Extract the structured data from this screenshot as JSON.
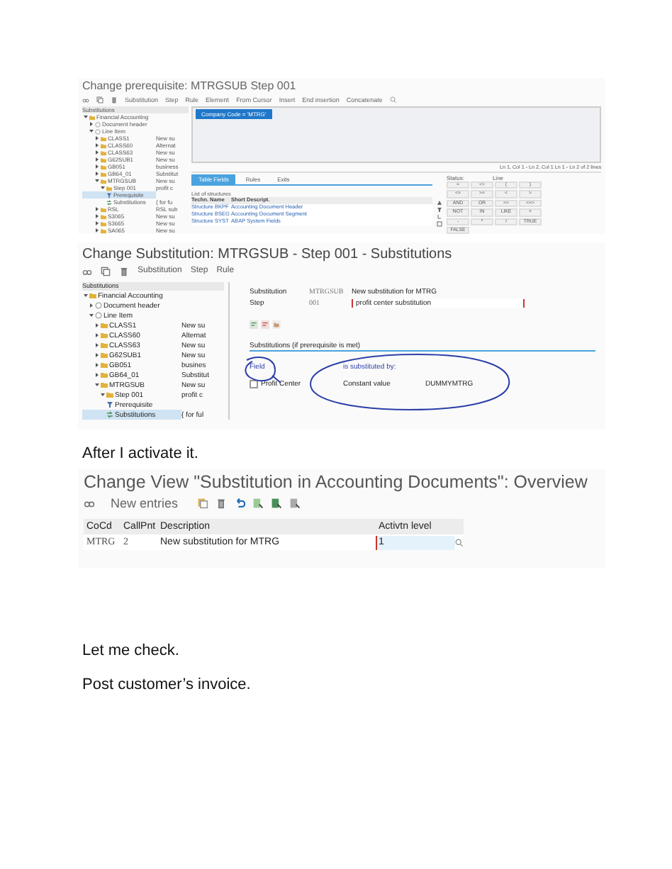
{
  "prerequisite_screen": {
    "title": "Change prerequisite: MTRGSUB Step 001",
    "toolbar": [
      "Substitution",
      "Step",
      "Rule",
      "Element",
      "From Cursor",
      "Insert",
      "End insertion",
      "Concatenate"
    ],
    "tree_header": "Substitutions",
    "tree": [
      {
        "label": "Financial Accounting",
        "kind": "folder",
        "expanded": true,
        "selected": false,
        "children": [
          {
            "label": "Document header",
            "kind": "node",
            "expanded": false,
            "selected": false
          },
          {
            "label": "Line Item",
            "kind": "node",
            "expanded": true,
            "selected": false,
            "children": [
              {
                "label": "CLASS1",
                "kind": "folder",
                "expanded": false,
                "selected": false,
                "note": "New su"
              },
              {
                "label": "CLASS60",
                "kind": "folder",
                "expanded": false,
                "selected": false,
                "note": "Alternat"
              },
              {
                "label": "CLASS63",
                "kind": "folder",
                "expanded": false,
                "selected": false,
                "note": "New su"
              },
              {
                "label": "G62SUB1",
                "kind": "folder",
                "expanded": false,
                "selected": false,
                "note": "New su"
              },
              {
                "label": "GB051",
                "kind": "folder",
                "expanded": false,
                "selected": false,
                "note": "business"
              },
              {
                "label": "GB64_01",
                "kind": "folder",
                "expanded": false,
                "selected": false,
                "note": "Substitut"
              },
              {
                "label": "MTRGSUB",
                "kind": "folder",
                "expanded": true,
                "selected": false,
                "note": "New su",
                "children": [
                  {
                    "label": "Step 001",
                    "kind": "folder",
                    "expanded": true,
                    "selected": false,
                    "note": "profit c",
                    "children": [
                      {
                        "label": "Prerequisite",
                        "kind": "prerequisite",
                        "selected": true
                      },
                      {
                        "label": "Substitutions",
                        "kind": "substitution",
                        "selected": false,
                        "note": "{ for fu"
                      }
                    ]
                  }
                ]
              },
              {
                "label": "RSL",
                "kind": "folder",
                "expanded": false,
                "selected": false,
                "note": "RSL sub"
              },
              {
                "label": "S3065",
                "kind": "folder",
                "expanded": false,
                "selected": false,
                "note": "New su"
              },
              {
                "label": "S3665",
                "kind": "folder",
                "expanded": false,
                "selected": false,
                "note": "New su"
              },
              {
                "label": "SA065",
                "kind": "folder",
                "expanded": false,
                "selected": false,
                "note": "New su"
              }
            ]
          }
        ]
      }
    ],
    "editor_token": "Company Code = 'MTRG'",
    "cursor_status": "Ln 1, Col 1 - Ln 2, Col 1  Ln 1 - Ln 2 of 2 lines",
    "tabs": [
      {
        "label": "Table Fields",
        "selected": true
      },
      {
        "label": "Rules",
        "selected": false
      },
      {
        "label": "Exits",
        "selected": false
      }
    ],
    "list_title": "List of structures",
    "columns": [
      "Techn. Name",
      "Short Descript."
    ],
    "rows": [
      [
        "Structure BKPF",
        "Accounting Document Header"
      ],
      [
        "Structure BSEG",
        "Accounting Document Segment"
      ],
      [
        "Structure SYST",
        "ABAP System Fields"
      ]
    ],
    "status_label": "Status:",
    "line_label": "Line",
    "operators": [
      "=",
      "<>",
      "(",
      ")",
      "<=",
      ">=",
      "<",
      ">",
      "AND",
      "OR",
      "=>",
      "<=>",
      "NOT",
      "IN",
      "LIKE",
      "+",
      "-",
      "*",
      "/",
      "TRUE",
      "FALSE"
    ]
  },
  "substitution_screen": {
    "title": "Change Substitution: MTRGSUB - Step 001 - Substitutions",
    "toolbar": [
      "Substitution",
      "Step",
      "Rule"
    ],
    "tree_header": "Substitutions",
    "tree": [
      {
        "label": "Financial Accounting",
        "kind": "folder",
        "expanded": true,
        "selected": false,
        "children": [
          {
            "label": "Document header",
            "kind": "node",
            "expanded": false,
            "selected": false
          },
          {
            "label": "Line Item",
            "kind": "node",
            "expanded": true,
            "selected": false,
            "children": [
              {
                "label": "CLASS1",
                "kind": "folder",
                "expanded": false,
                "selected": false,
                "note": "New su"
              },
              {
                "label": "CLASS60",
                "kind": "folder",
                "expanded": false,
                "selected": false,
                "note": "Alternat"
              },
              {
                "label": "CLASS63",
                "kind": "folder",
                "expanded": false,
                "selected": false,
                "note": "New su"
              },
              {
                "label": "G62SUB1",
                "kind": "folder",
                "expanded": false,
                "selected": false,
                "note": "New su"
              },
              {
                "label": "GB051",
                "kind": "folder",
                "expanded": false,
                "selected": false,
                "note": "busines"
              },
              {
                "label": "GB64_01",
                "kind": "folder",
                "expanded": false,
                "selected": false,
                "note": "Substitut"
              },
              {
                "label": "MTRGSUB",
                "kind": "folder",
                "expanded": true,
                "selected": false,
                "note": "New su",
                "children": [
                  {
                    "label": "Step 001",
                    "kind": "folder",
                    "expanded": true,
                    "selected": false,
                    "note": "profit c",
                    "children": [
                      {
                        "label": "Prerequisite",
                        "kind": "prerequisite",
                        "selected": false
                      },
                      {
                        "label": "Substitutions",
                        "kind": "substitution",
                        "selected": true,
                        "note": "{ for ful"
                      }
                    ]
                  }
                ]
              }
            ]
          }
        ]
      }
    ],
    "fields": [
      {
        "label": "Substitution",
        "code": "MTRGSUB",
        "value": "New substitution for MTRG",
        "kind": "text"
      },
      {
        "label": "Step",
        "code": "001",
        "value": "profit center substitution",
        "kind": "input"
      }
    ],
    "section_title": "Substitutions (if prerequisite is met)",
    "field_header": "Field",
    "substituted_header": "is substituted by:",
    "substitution_row": {
      "field": "Profit Center",
      "checked": false,
      "method": "Constant value",
      "value": "DUMMYMTRG"
    }
  },
  "caption_1": "After I activate it.",
  "overview_screen": {
    "title": "Change View \"Substitution in Accounting Documents\": Overview",
    "new_entries": "New entries",
    "columns": [
      "CoCd",
      "CallPnt",
      "Description",
      "Activtn level"
    ],
    "rows": [
      {
        "cocd": "MTRG",
        "callpnt": "2",
        "description": "New substitution for MTRG",
        "level_value": "1"
      }
    ]
  },
  "paragraphs": [
    "Let me check.",
    "Post customer’s invoice."
  ]
}
